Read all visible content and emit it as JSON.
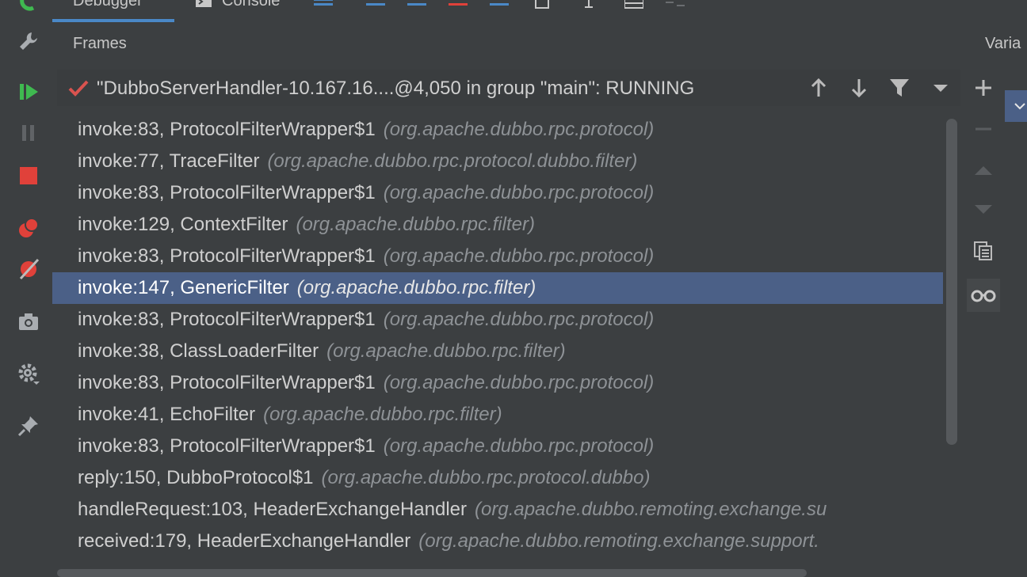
{
  "tabs": [
    {
      "label": "Debugger",
      "active": true
    },
    {
      "label": "Console",
      "active": false
    }
  ],
  "frames_panel": {
    "title": "Frames",
    "thread": {
      "text": "\"DubboServerHandler-10.167.16....@4,050 in group \"main\": RUNNING",
      "status_color": "#d9534f"
    }
  },
  "variables_panel": {
    "title": "Varia"
  },
  "frames": [
    {
      "method": "invoke:83, ProtocolFilterWrapper$1",
      "package": "(org.apache.dubbo.rpc.protocol)",
      "selected": false
    },
    {
      "method": "invoke:77, TraceFilter",
      "package": "(org.apache.dubbo.rpc.protocol.dubbo.filter)",
      "selected": false
    },
    {
      "method": "invoke:83, ProtocolFilterWrapper$1",
      "package": "(org.apache.dubbo.rpc.protocol)",
      "selected": false
    },
    {
      "method": "invoke:129, ContextFilter",
      "package": "(org.apache.dubbo.rpc.filter)",
      "selected": false
    },
    {
      "method": "invoke:83, ProtocolFilterWrapper$1",
      "package": "(org.apache.dubbo.rpc.protocol)",
      "selected": false
    },
    {
      "method": "invoke:147, GenericFilter",
      "package": "(org.apache.dubbo.rpc.filter)",
      "selected": true
    },
    {
      "method": "invoke:83, ProtocolFilterWrapper$1",
      "package": "(org.apache.dubbo.rpc.protocol)",
      "selected": false
    },
    {
      "method": "invoke:38, ClassLoaderFilter",
      "package": "(org.apache.dubbo.rpc.filter)",
      "selected": false
    },
    {
      "method": "invoke:83, ProtocolFilterWrapper$1",
      "package": "(org.apache.dubbo.rpc.protocol)",
      "selected": false
    },
    {
      "method": "invoke:41, EchoFilter",
      "package": "(org.apache.dubbo.rpc.filter)",
      "selected": false
    },
    {
      "method": "invoke:83, ProtocolFilterWrapper$1",
      "package": "(org.apache.dubbo.rpc.protocol)",
      "selected": false
    },
    {
      "method": "reply:150, DubboProtocol$1",
      "package": "(org.apache.dubbo.rpc.protocol.dubbo)",
      "selected": false
    },
    {
      "method": "handleRequest:103, HeaderExchangeHandler",
      "package": "(org.apache.dubbo.remoting.exchange.su",
      "selected": false
    },
    {
      "method": "received:179, HeaderExchangeHandler",
      "package": "(org.apache.dubbo.remoting.exchange.support.",
      "selected": false
    }
  ],
  "icons": {
    "left_toolbar": [
      "wrench-icon",
      "resume-icon",
      "pause-icon",
      "stop-icon",
      "view-breakpoints-icon",
      "mute-breakpoints-icon",
      "camera-icon",
      "settings-icon",
      "pin-icon"
    ],
    "thread_toolbar": [
      "arrow-up-icon",
      "arrow-down-icon",
      "filter-icon",
      "dropdown-icon"
    ],
    "right_toolbar": [
      "add-watch-icon",
      "remove-watch-icon",
      "move-up-icon",
      "move-down-icon",
      "copy-icon",
      "glasses-icon"
    ]
  },
  "colors": {
    "background": "#3c3f41",
    "selection": "#4b6087",
    "accent": "#4a88c7",
    "resume_green": "#3fb950",
    "stop_red": "#e0413a"
  }
}
